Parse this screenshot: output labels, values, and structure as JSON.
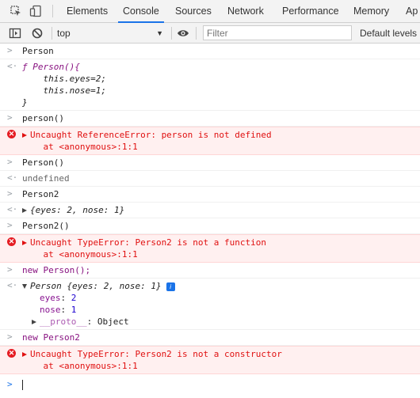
{
  "tabs": [
    "Elements",
    "Console",
    "Sources",
    "Network",
    "Performance",
    "Memory",
    "Ap"
  ],
  "active_tab": "Console",
  "toolbar": {
    "context": "top",
    "filter_placeholder": "Filter",
    "levels": "Default levels"
  },
  "console": [
    {
      "kind": "input",
      "text": "Person"
    },
    {
      "kind": "output_fn",
      "lines": [
        "ƒ Person(){",
        "    this.eyes=2;",
        "    this.nose=1;",
        "}"
      ]
    },
    {
      "kind": "input",
      "text": "person()"
    },
    {
      "kind": "error",
      "message": "Uncaught ReferenceError: person is not defined",
      "trace": "    at <anonymous>:1:1"
    },
    {
      "kind": "input",
      "text": "Person()"
    },
    {
      "kind": "output",
      "text": "undefined"
    },
    {
      "kind": "input",
      "text": "Person2"
    },
    {
      "kind": "output_obj",
      "text": "{eyes: 2, nose: 1}"
    },
    {
      "kind": "input",
      "text": "Person2()"
    },
    {
      "kind": "error",
      "message": "Uncaught TypeError: Person2 is not a function",
      "trace": "    at <anonymous>:1:1"
    },
    {
      "kind": "input",
      "text": "new Person();"
    },
    {
      "kind": "output_expanded",
      "summary": "Person {eyes: 2, nose: 1}",
      "props": [
        {
          "key": "eyes",
          "value": "2"
        },
        {
          "key": "nose",
          "value": "1"
        }
      ],
      "proto_key": "__proto__",
      "proto_value": "Object"
    },
    {
      "kind": "input",
      "text": "new Person2"
    },
    {
      "kind": "error",
      "message": "Uncaught TypeError: Person2 is not a constructor",
      "trace": "    at <anonymous>:1:1"
    }
  ],
  "prompt_symbol": ">",
  "return_symbol": "<·",
  "icons": {
    "inspect": "inspect-element-icon",
    "device": "device-toolbar-icon",
    "sidebar": "console-sidebar-icon",
    "clear": "clear-console-icon",
    "eye": "live-expression-eye-icon",
    "error": "error-icon",
    "info": "info-icon"
  },
  "colors": {
    "accent": "#1a73e8",
    "error_bg": "#fff0f0",
    "error_text": "#e01010"
  }
}
